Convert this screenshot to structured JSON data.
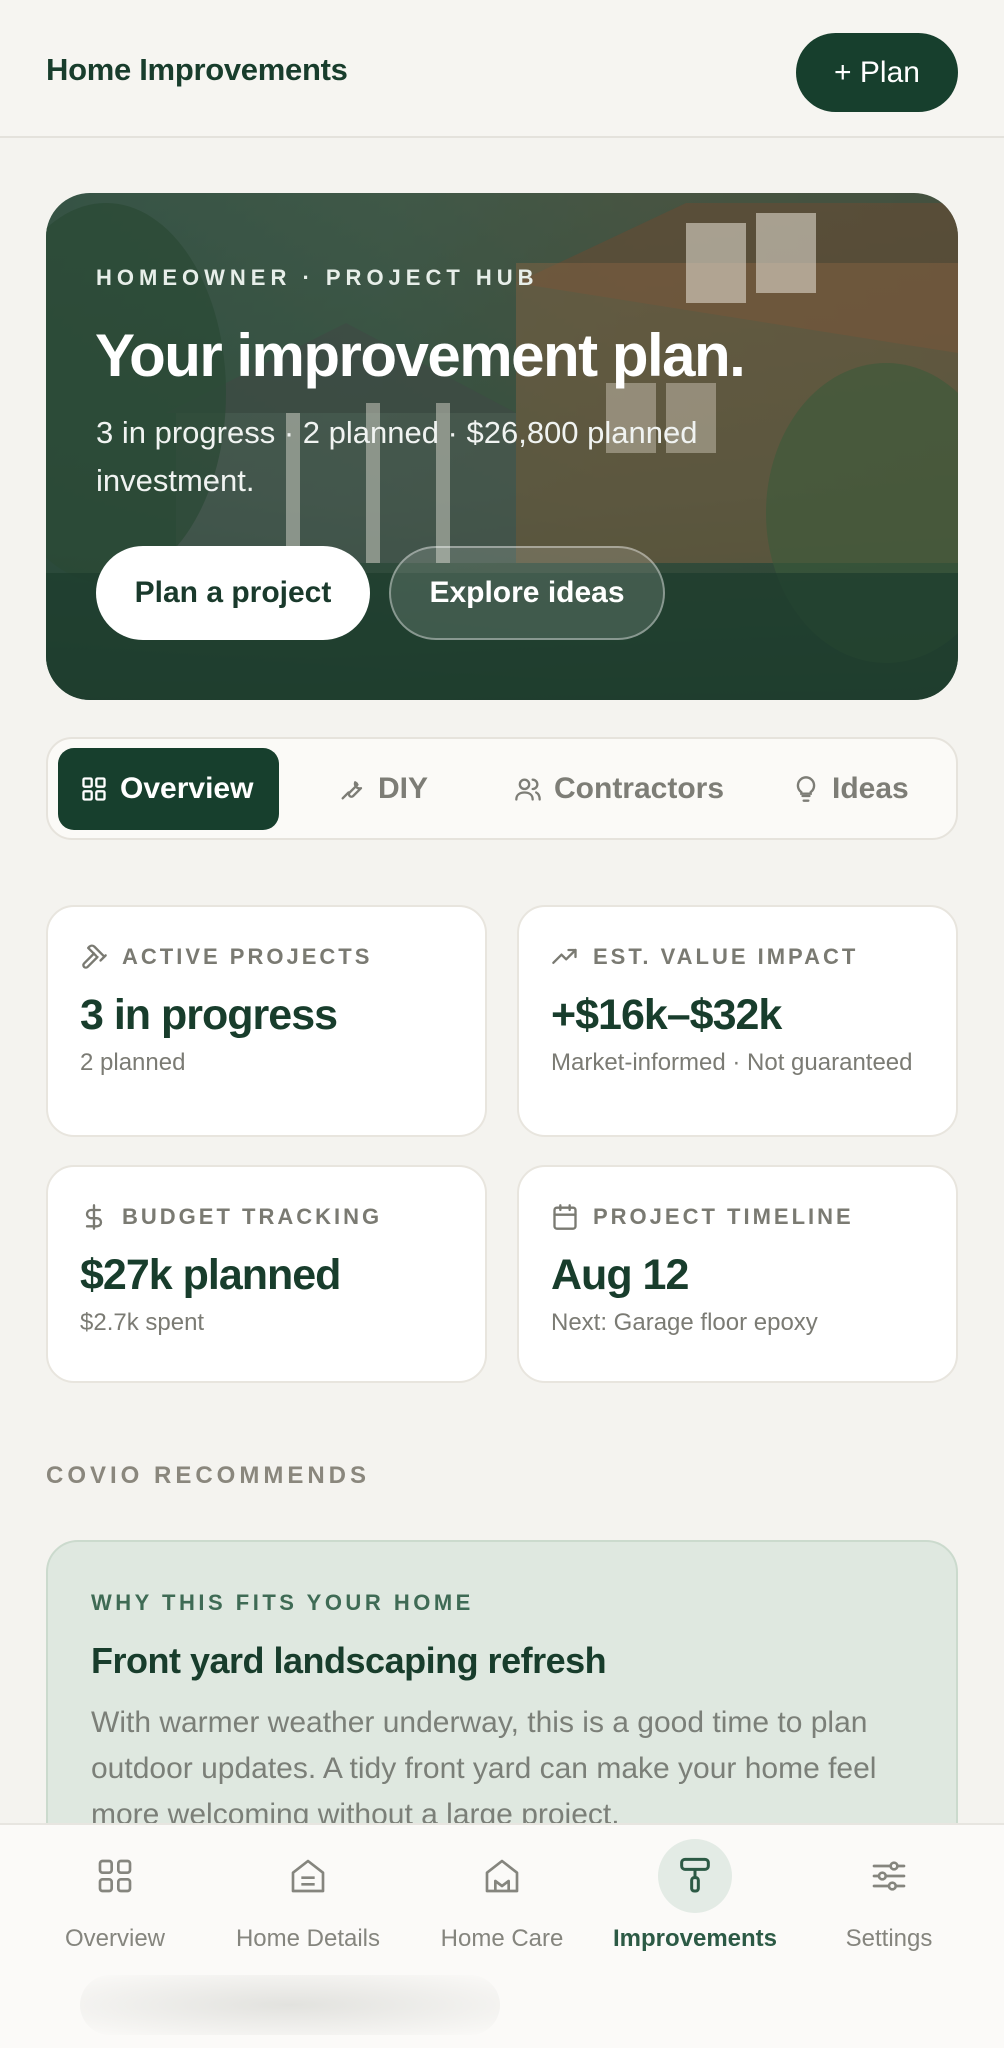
{
  "header": {
    "title": "Home Improvements",
    "plan_button": "+ Plan"
  },
  "hero": {
    "eyebrow": "HOMEOWNER · PROJECT HUB",
    "title": "Your improvement plan.",
    "subtitle": "3 in progress · 2 planned · $26,800 planned investment.",
    "primary_button": "Plan a project",
    "secondary_button": "Explore ideas"
  },
  "tabs": [
    {
      "label": "Overview",
      "icon": "grid-icon",
      "active": true
    },
    {
      "label": "DIY",
      "icon": "wrench-icon",
      "active": false
    },
    {
      "label": "Contractors",
      "icon": "users-icon",
      "active": false
    },
    {
      "label": "Ideas",
      "icon": "lightbulb-icon",
      "active": false
    }
  ],
  "cards": [
    {
      "label": "ACTIVE PROJECTS",
      "icon": "hammer-icon",
      "value": "3 in progress",
      "sub": "2 planned"
    },
    {
      "label": "EST. VALUE IMPACT",
      "icon": "trending-up-icon",
      "value": "+$16k–$32k",
      "sub": "Market-informed · Not guaranteed"
    },
    {
      "label": "BUDGET TRACKING",
      "icon": "dollar-icon",
      "value": "$27k planned",
      "sub": "$2.7k spent"
    },
    {
      "label": "PROJECT TIMELINE",
      "icon": "calendar-icon",
      "value": "Aug 12",
      "sub": "Next: Garage floor epoxy"
    }
  ],
  "recommendations": {
    "section_title": "COVIO RECOMMENDS",
    "eyebrow": "WHY THIS FITS YOUR HOME",
    "title": "Front yard landscaping refresh",
    "body": "With warmer weather underway, this is a good time to plan outdoor updates. A tidy front yard can make your home feel more welcoming without a large project."
  },
  "bottom_nav": [
    {
      "label": "Overview",
      "icon": "grid-icon",
      "active": false
    },
    {
      "label": "Home Details",
      "icon": "house-details-icon",
      "active": false
    },
    {
      "label": "Home Care",
      "icon": "house-care-icon",
      "active": false
    },
    {
      "label": "Improvements",
      "icon": "paint-roller-icon",
      "active": true
    },
    {
      "label": "Settings",
      "icon": "sliders-icon",
      "active": false
    }
  ],
  "colors": {
    "brand_dark": "#173f2d",
    "background": "#f4f3ef",
    "recommend_bg": "#dfe8e0"
  }
}
